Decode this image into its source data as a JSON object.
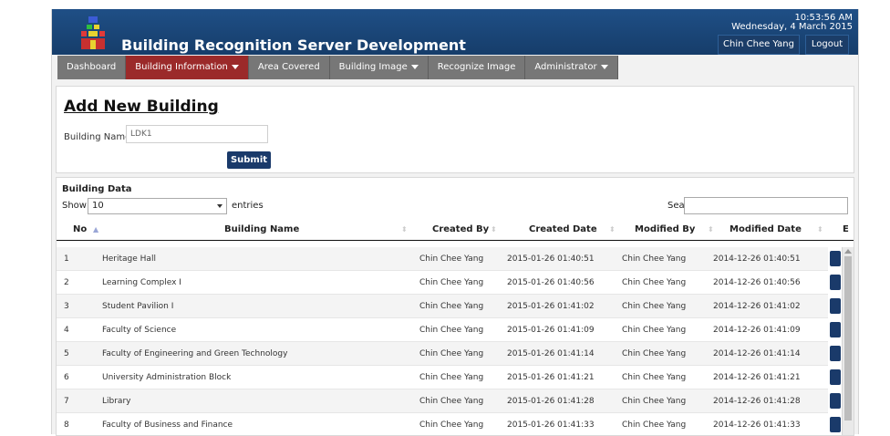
{
  "header": {
    "title": "Building Recognition Server Development",
    "time": "10:53:56 AM",
    "date": "Wednesday, 4 March 2015",
    "user_button": "Chin Chee Yang",
    "logout_button": "Logout"
  },
  "nav": {
    "items": [
      {
        "label": "Dashboard"
      },
      {
        "label": "Building Information"
      },
      {
        "label": "Area Covered"
      },
      {
        "label": "Building Image"
      },
      {
        "label": "Recognize Image"
      },
      {
        "label": "Administrator"
      }
    ],
    "active": "Building Information",
    "active_color": "#9b2a2a",
    "inactive_color": "#777777"
  },
  "form": {
    "title": "Add New Building",
    "building_name_label": "Building Name",
    "building_name_value": "LDK1",
    "submit_label": "Submit"
  },
  "table": {
    "section_title": "Building Data",
    "show_label": "Show",
    "page_length": "10",
    "entries_label": "entries",
    "search_label": "Search:",
    "columns": [
      "No",
      "Building Name",
      "Created By",
      "Created Date",
      "Modified By",
      "Modified Date",
      "E"
    ],
    "rows": [
      {
        "no": "1",
        "name": "Heritage Hall",
        "created_by": "Chin Chee Yang",
        "created_date": "2015-01-26 01:40:51",
        "modified_by": "Chin Chee Yang",
        "modified_date": "2014-12-26 01:40:51"
      },
      {
        "no": "2",
        "name": "Learning Complex I",
        "created_by": "Chin Chee Yang",
        "created_date": "2015-01-26 01:40:56",
        "modified_by": "Chin Chee Yang",
        "modified_date": "2014-12-26 01:40:56"
      },
      {
        "no": "3",
        "name": "Student Pavilion I",
        "created_by": "Chin Chee Yang",
        "created_date": "2015-01-26 01:41:02",
        "modified_by": "Chin Chee Yang",
        "modified_date": "2014-12-26 01:41:02"
      },
      {
        "no": "4",
        "name": "Faculty of Science",
        "created_by": "Chin Chee Yang",
        "created_date": "2015-01-26 01:41:09",
        "modified_by": "Chin Chee Yang",
        "modified_date": "2014-12-26 01:41:09"
      },
      {
        "no": "5",
        "name": "Faculty of Engineering and Green Technology",
        "created_by": "Chin Chee Yang",
        "created_date": "2015-01-26 01:41:14",
        "modified_by": "Chin Chee Yang",
        "modified_date": "2014-12-26 01:41:14"
      },
      {
        "no": "6",
        "name": "University Administration Block",
        "created_by": "Chin Chee Yang",
        "created_date": "2015-01-26 01:41:21",
        "modified_by": "Chin Chee Yang",
        "modified_date": "2014-12-26 01:41:21"
      },
      {
        "no": "7",
        "name": "Library",
        "created_by": "Chin Chee Yang",
        "created_date": "2015-01-26 01:41:28",
        "modified_by": "Chin Chee Yang",
        "modified_date": "2014-12-26 01:41:28"
      },
      {
        "no": "8",
        "name": "Faculty of Business and Finance",
        "created_by": "Chin Chee Yang",
        "created_date": "2015-01-26 01:41:33",
        "modified_by": "Chin Chee Yang",
        "modified_date": "2014-12-26 01:41:33"
      }
    ]
  },
  "colors": {
    "header_bg": "#1b4677",
    "submit_bg": "#1a3a6a"
  },
  "icons": [
    "building-logo-icon",
    "caret-down-icon",
    "sort-icon",
    "edit-icon"
  ]
}
